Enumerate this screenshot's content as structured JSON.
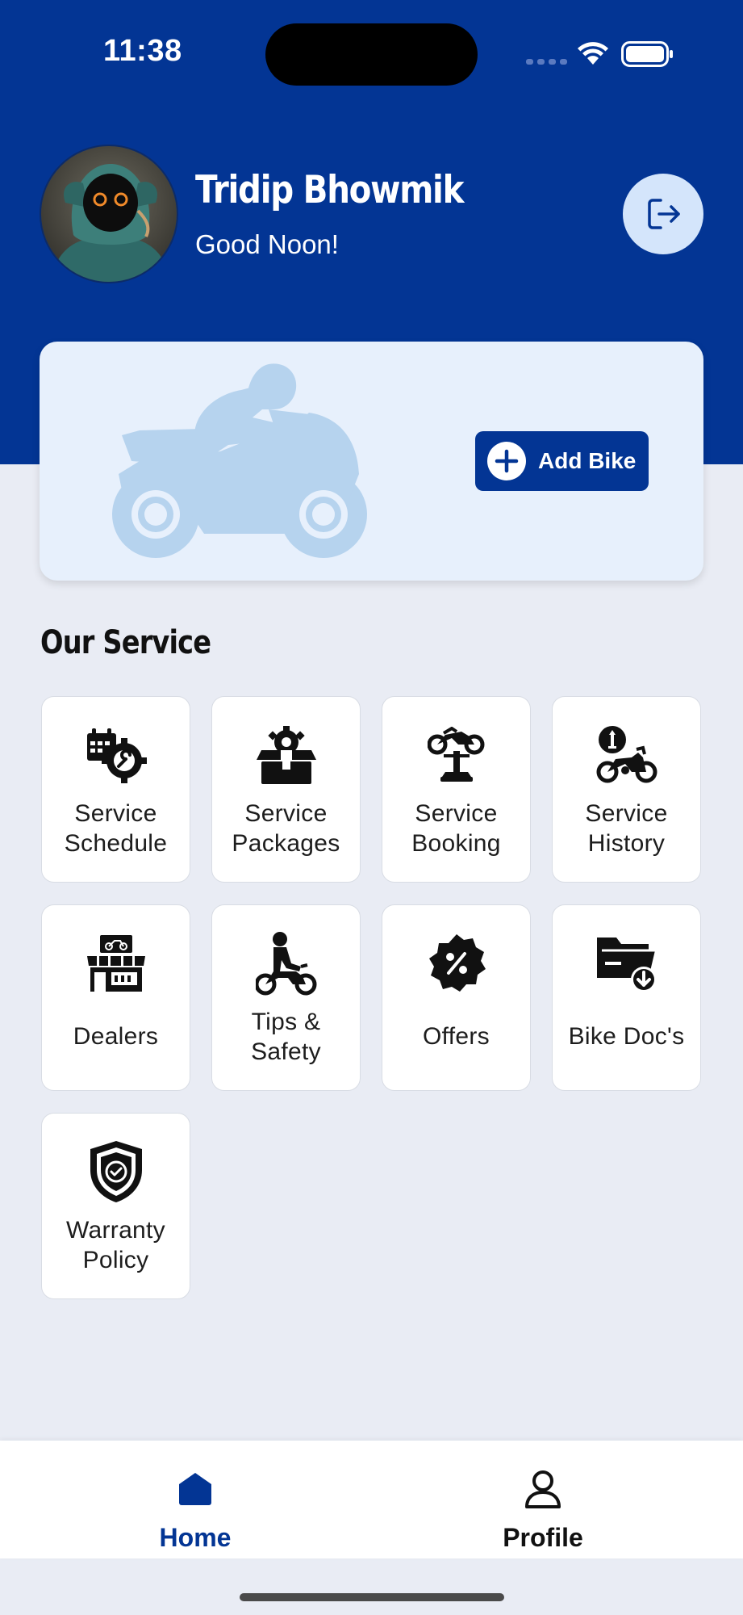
{
  "status_bar": {
    "time": "11:38"
  },
  "user": {
    "name": "Tridip Bhowmik",
    "greeting": "Good Noon!"
  },
  "bike_card": {
    "add_bike_label": "Add Bike"
  },
  "services_section": {
    "title": "Our Service",
    "items": [
      {
        "label": "Service\nSchedule",
        "icon": "schedule-gear-icon"
      },
      {
        "label": "Service\nPackages",
        "icon": "package-box-icon"
      },
      {
        "label": "Service\nBooking",
        "icon": "bike-lift-icon"
      },
      {
        "label": "Service\nHistory",
        "icon": "bike-history-icon"
      },
      {
        "label": "Dealers",
        "icon": "dealer-shop-icon"
      },
      {
        "label": "Tips &\nSafety",
        "icon": "rider-icon"
      },
      {
        "label": "Offers",
        "icon": "percent-badge-icon"
      },
      {
        "label": "Bike Doc's",
        "icon": "folder-download-icon"
      },
      {
        "label": "Warranty\nPolicy",
        "icon": "shield-check-icon"
      }
    ]
  },
  "bottom_nav": {
    "home_label": "Home",
    "profile_label": "Profile",
    "active": "Home"
  },
  "colors": {
    "primary": "#033594",
    "background": "#e9ecf4",
    "card_tint": "#e7f0fc",
    "silhouette": "#b6d3ee",
    "logout_bg": "#d4e5fb"
  }
}
